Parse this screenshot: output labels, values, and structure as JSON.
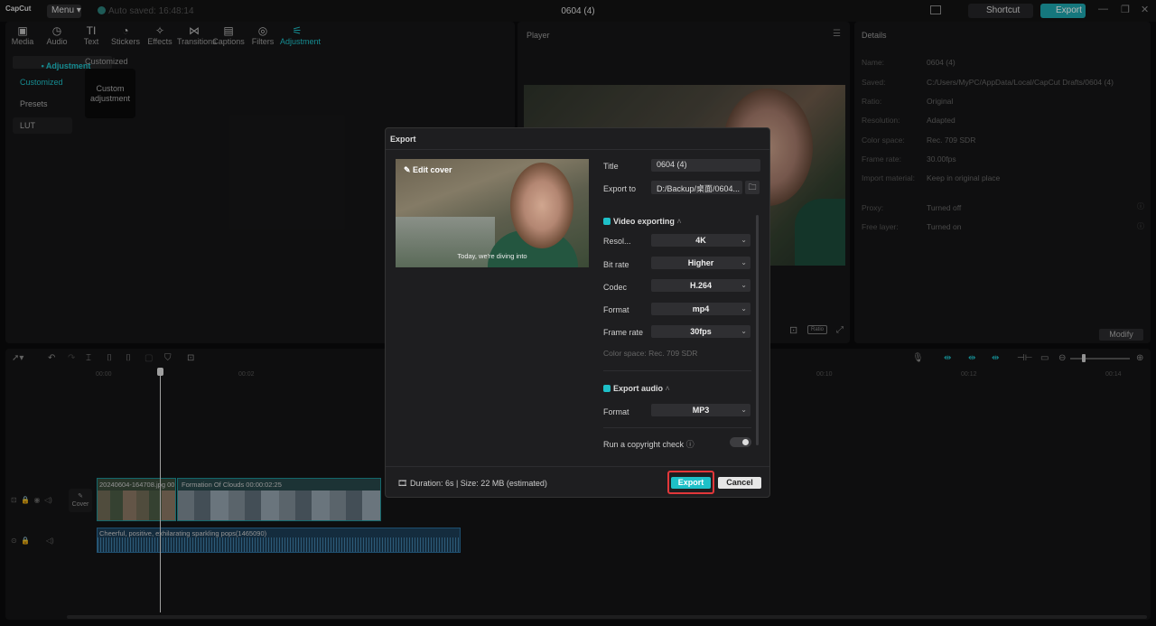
{
  "app": {
    "logo": "CapCut",
    "menu": "Menu",
    "autosave": "Auto saved: 16:48:14",
    "project_title": "0604 (4)",
    "shortcut": "Shortcut",
    "export": "Export"
  },
  "toolbar": [
    {
      "icon": "media-icon",
      "glyph": "▣",
      "label": "Media"
    },
    {
      "icon": "audio-icon",
      "glyph": "◷",
      "label": "Audio"
    },
    {
      "icon": "text-icon",
      "glyph": "TI",
      "label": "Text"
    },
    {
      "icon": "stickers-icon",
      "glyph": "◔",
      "label": "Stickers"
    },
    {
      "icon": "effects-icon",
      "glyph": "✧",
      "label": "Effects"
    },
    {
      "icon": "transitions-icon",
      "glyph": "⋈",
      "label": "Transitions"
    },
    {
      "icon": "captions-icon",
      "glyph": "▤",
      "label": "Captions"
    },
    {
      "icon": "filters-icon",
      "glyph": "◎",
      "label": "Filters"
    },
    {
      "icon": "adjustment-icon",
      "glyph": "⚟",
      "label": "Adjustment"
    }
  ],
  "sidenav": {
    "adjustment": "• Adjustment",
    "customized": "Customized",
    "presets": "Presets",
    "lut": "LUT"
  },
  "adjust": {
    "section": "Customized",
    "card_line1": "Custom",
    "card_line2": "adjustment"
  },
  "player": {
    "label": "Player",
    "ratio": "Ratio"
  },
  "details": {
    "title": "Details",
    "rows": [
      {
        "k": "Name:",
        "v": "0604 (4)"
      },
      {
        "k": "Saved:",
        "v": "C:/Users/MyPC/AppData/Local/CapCut Drafts/0604 (4)"
      },
      {
        "k": "Ratio:",
        "v": "Original"
      },
      {
        "k": "Resolution:",
        "v": "Adapted"
      },
      {
        "k": "Color space:",
        "v": "Rec. 709 SDR"
      },
      {
        "k": "Frame rate:",
        "v": "30.00fps"
      },
      {
        "k": "Import material:",
        "v": "Keep in original place"
      },
      {
        "k": "Proxy:",
        "v": "Turned off"
      },
      {
        "k": "Free layer:",
        "v": "Turned on"
      }
    ],
    "modify": "Modify"
  },
  "timeline": {
    "ticks": [
      "00:00",
      "00:02",
      "00:10",
      "00:12",
      "00:14"
    ],
    "clip1": "20240604-164708.jpg  00",
    "clip2": "Formation Of Clouds   00:00:02:25",
    "audio": "Cheerful, positive, exhilarating sparkling pops(1465090)",
    "cover": "Cover"
  },
  "dialog": {
    "title": "Export",
    "edit_cover": "Edit cover",
    "subtitle": "Today, we're diving into",
    "title_label": "Title",
    "title_value": "0604 (4)",
    "export_to_label": "Export to",
    "export_to_value": "D:/Backup/桌面/0604...",
    "video_section": "Video exporting",
    "resolution_label": "Resol...",
    "resolution_value": "4K",
    "bitrate_label": "Bit rate",
    "bitrate_value": "Higher",
    "codec_label": "Codec",
    "codec_value": "H.264",
    "format_label": "Format",
    "format_value": "mp4",
    "framerate_label": "Frame rate",
    "framerate_value": "30fps",
    "colorspace": "Color space: Rec. 709 SDR",
    "audio_section": "Export audio",
    "audio_format_label": "Format",
    "audio_format_value": "MP3",
    "copyright_label": "Run a copyright check",
    "duration": "Duration: 6s | Size: 22 MB (estimated)",
    "export_button": "Export",
    "cancel_button": "Cancel"
  }
}
